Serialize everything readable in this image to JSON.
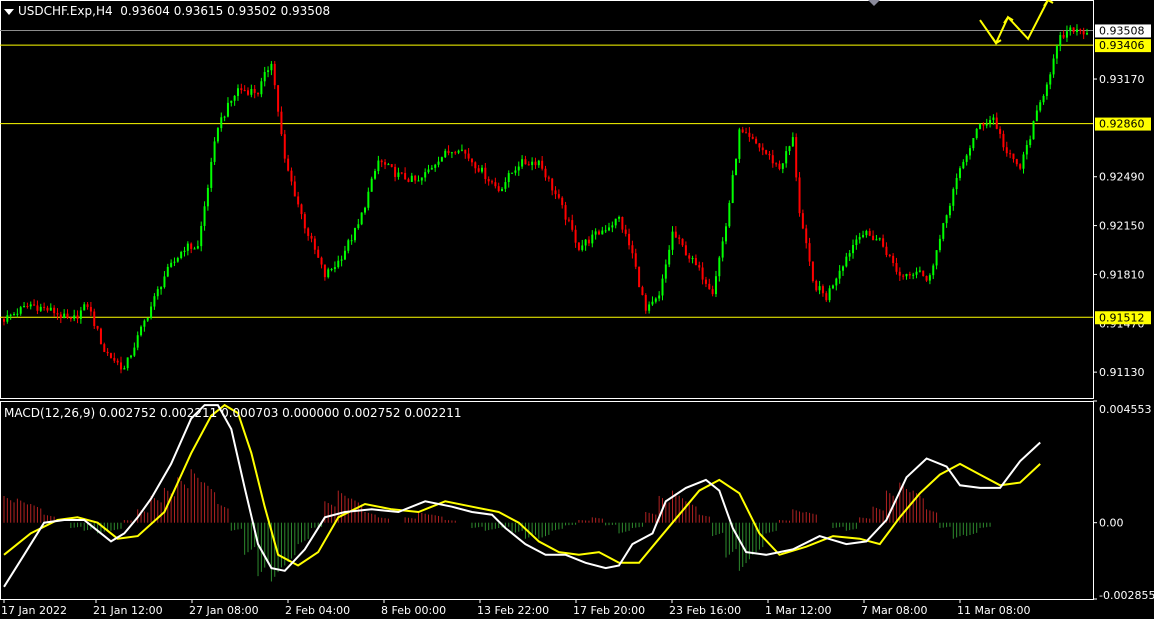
{
  "header": {
    "symbol": "USDCHF.Exp,H4",
    "ohlc": "0.93604 0.93615 0.93502 0.93508"
  },
  "macd_header": {
    "label": "MACD(12,26,9) 0.002752 0.002211 0.000703 0.000000 0.002752 0.002211"
  },
  "colors": {
    "background": "#000000",
    "bull_candle": "#00ff00",
    "bear_candle": "#ff0000",
    "level_line": "#ffff00",
    "macd_line": "#ffffff",
    "signal_line": "#ffff00",
    "hist_pos": "#b22222",
    "hist_neg": "#2e8b2e",
    "grid_frame": "#ffffff"
  },
  "chart_data": [
    {
      "type": "candlestick",
      "panel": "price",
      "ylim": [
        0.9095,
        0.9372
      ],
      "y_ticks": [
        "0.93170",
        "0.92490",
        "0.92150",
        "0.91810",
        "0.91130"
      ],
      "current_price": "0.93508",
      "levels": [
        {
          "value": 0.93406,
          "label": "0.93406"
        },
        {
          "value": 0.9286,
          "label": "0.92860"
        },
        {
          "value": 0.91512,
          "label": "0.91512"
        }
      ],
      "overlap_tick": "0.91470",
      "x_tick_labels": [
        "17 Jan 2022",
        "21 Jan 12:00",
        "27 Jan 08:00",
        "2 Feb 04:00",
        "8 Feb 00:00",
        "13 Feb 22:00",
        "17 Feb 20:00",
        "23 Feb 16:00",
        "1 Mar 12:00",
        "7 Mar 08:00",
        "11 Mar 08:00"
      ],
      "close_path": [
        [
          0,
          0.915
        ],
        [
          8,
          0.916
        ],
        [
          15,
          0.9155
        ],
        [
          20,
          0.9148
        ],
        [
          25,
          0.916
        ],
        [
          30,
          0.9128
        ],
        [
          36,
          0.9115
        ],
        [
          42,
          0.9148
        ],
        [
          48,
          0.918
        ],
        [
          54,
          0.92
        ],
        [
          58,
          0.92
        ],
        [
          64,
          0.9285
        ],
        [
          70,
          0.931
        ],
        [
          76,
          0.9308
        ],
        [
          80,
          0.933
        ],
        [
          84,
          0.926
        ],
        [
          90,
          0.9215
        ],
        [
          96,
          0.918
        ],
        [
          100,
          0.919
        ],
        [
          106,
          0.9215
        ],
        [
          112,
          0.926
        ],
        [
          118,
          0.925
        ],
        [
          124,
          0.9245
        ],
        [
          130,
          0.9262
        ],
        [
          136,
          0.927
        ],
        [
          142,
          0.9255
        ],
        [
          148,
          0.924
        ],
        [
          154,
          0.9258
        ],
        [
          160,
          0.926
        ],
        [
          166,
          0.9232
        ],
        [
          172,
          0.92
        ],
        [
          178,
          0.921
        ],
        [
          184,
          0.922
        ],
        [
          188,
          0.9195
        ],
        [
          192,
          0.9155
        ],
        [
          196,
          0.9165
        ],
        [
          200,
          0.921
        ],
        [
          206,
          0.919
        ],
        [
          212,
          0.917
        ],
        [
          216,
          0.9215
        ],
        [
          220,
          0.928
        ],
        [
          226,
          0.927
        ],
        [
          232,
          0.9255
        ],
        [
          236,
          0.9275
        ],
        [
          238,
          0.9225
        ],
        [
          242,
          0.9175
        ],
        [
          246,
          0.9165
        ],
        [
          250,
          0.9185
        ],
        [
          256,
          0.921
        ],
        [
          262,
          0.9205
        ],
        [
          268,
          0.918
        ],
        [
          274,
          0.9185
        ],
        [
          276,
          0.9175
        ],
        [
          280,
          0.9205
        ],
        [
          284,
          0.924
        ],
        [
          288,
          0.9265
        ],
        [
          292,
          0.9285
        ],
        [
          296,
          0.929
        ],
        [
          300,
          0.9265
        ],
        [
          304,
          0.9255
        ],
        [
          308,
          0.9285
        ],
        [
          312,
          0.9315
        ],
        [
          316,
          0.9345
        ],
        [
          320,
          0.9352
        ],
        [
          324,
          0.935
        ]
      ],
      "forecast_arrow": [
        [
          0.9358,
          0.9342
        ],
        [
          0.9342,
          0.936
        ],
        [
          0.936,
          0.9345
        ],
        [
          0.9345,
          0.9372
        ]
      ]
    },
    {
      "type": "macd",
      "panel": "indicator",
      "ylim": [
        -0.002855,
        0.004553
      ],
      "y_ticks": [
        "0.004553",
        "0.00",
        "-0.002855"
      ],
      "macd": [
        [
          0,
          -0.0024
        ],
        [
          6,
          -0.0012
        ],
        [
          12,
          0.0
        ],
        [
          18,
          0.0001
        ],
        [
          24,
          0.0001
        ],
        [
          28,
          -0.0003
        ],
        [
          32,
          -0.0007
        ],
        [
          36,
          -0.0004
        ],
        [
          40,
          0.0002
        ],
        [
          44,
          0.0009
        ],
        [
          50,
          0.0022
        ],
        [
          56,
          0.0039
        ],
        [
          60,
          0.0044
        ],
        [
          64,
          0.0044
        ],
        [
          68,
          0.0035
        ],
        [
          72,
          0.0013
        ],
        [
          76,
          -0.0008
        ],
        [
          80,
          -0.0017
        ],
        [
          84,
          -0.0018
        ],
        [
          90,
          -0.001
        ],
        [
          96,
          0.0002
        ],
        [
          102,
          0.0004
        ],
        [
          110,
          0.0005
        ],
        [
          118,
          0.0004
        ],
        [
          126,
          0.0008
        ],
        [
          134,
          0.0006
        ],
        [
          140,
          0.0004
        ],
        [
          146,
          0.0003
        ],
        [
          150,
          -0.0002
        ],
        [
          156,
          -0.0008
        ],
        [
          162,
          -0.0012
        ],
        [
          168,
          -0.0012
        ],
        [
          174,
          -0.0015
        ],
        [
          180,
          -0.0017
        ],
        [
          184,
          -0.0016
        ],
        [
          188,
          -0.0008
        ],
        [
          194,
          -0.0004
        ],
        [
          198,
          0.0008
        ],
        [
          204,
          0.0013
        ],
        [
          210,
          0.0016
        ],
        [
          214,
          0.0012
        ],
        [
          218,
          -0.0002
        ],
        [
          222,
          -0.0011
        ],
        [
          228,
          -0.0012
        ],
        [
          236,
          -0.001
        ],
        [
          244,
          -0.0005
        ],
        [
          252,
          -0.0008
        ],
        [
          258,
          -0.0007
        ],
        [
          264,
          0.0001
        ],
        [
          270,
          0.0017
        ],
        [
          276,
          0.0024
        ],
        [
          282,
          0.0021
        ],
        [
          286,
          0.0014
        ],
        [
          292,
          0.0013
        ],
        [
          298,
          0.0013
        ],
        [
          304,
          0.0023
        ],
        [
          310,
          0.003
        ]
      ],
      "signal": [
        [
          0,
          -0.0012
        ],
        [
          8,
          -0.0004
        ],
        [
          16,
          0.0001
        ],
        [
          22,
          0.0002
        ],
        [
          28,
          0.0
        ],
        [
          34,
          -0.0006
        ],
        [
          40,
          -0.0005
        ],
        [
          48,
          0.0004
        ],
        [
          56,
          0.0026
        ],
        [
          62,
          0.004
        ],
        [
          66,
          0.0044
        ],
        [
          70,
          0.0041
        ],
        [
          74,
          0.0026
        ],
        [
          78,
          0.0006
        ],
        [
          82,
          -0.0012
        ],
        [
          88,
          -0.0016
        ],
        [
          94,
          -0.0011
        ],
        [
          100,
          0.0002
        ],
        [
          108,
          0.0007
        ],
        [
          116,
          0.0005
        ],
        [
          124,
          0.0004
        ],
        [
          132,
          0.0008
        ],
        [
          140,
          0.0006
        ],
        [
          148,
          0.0004
        ],
        [
          154,
          0.0
        ],
        [
          160,
          -0.0007
        ],
        [
          166,
          -0.0011
        ],
        [
          172,
          -0.0012
        ],
        [
          178,
          -0.0011
        ],
        [
          184,
          -0.0015
        ],
        [
          190,
          -0.0015
        ],
        [
          196,
          -0.0006
        ],
        [
          202,
          0.0003
        ],
        [
          208,
          0.0012
        ],
        [
          214,
          0.0016
        ],
        [
          220,
          0.0011
        ],
        [
          226,
          -0.0004
        ],
        [
          232,
          -0.0012
        ],
        [
          240,
          -0.0009
        ],
        [
          248,
          -0.0005
        ],
        [
          256,
          -0.0006
        ],
        [
          262,
          -0.0008
        ],
        [
          268,
          0.0002
        ],
        [
          274,
          0.0011
        ],
        [
          280,
          0.0018
        ],
        [
          286,
          0.0022
        ],
        [
          292,
          0.0018
        ],
        [
          298,
          0.0014
        ],
        [
          304,
          0.0015
        ],
        [
          310,
          0.0022
        ]
      ],
      "histogram": [
        [
          0,
          0.001
        ],
        [
          4,
          0.0009
        ],
        [
          8,
          0.0007
        ],
        [
          12,
          0.0003
        ],
        [
          16,
          0.0
        ],
        [
          20,
          -0.0002
        ],
        [
          24,
          -0.0003
        ],
        [
          28,
          -0.0004
        ],
        [
          32,
          -0.0003
        ],
        [
          36,
          0.0001
        ],
        [
          40,
          0.0005
        ],
        [
          44,
          0.001
        ],
        [
          48,
          0.0013
        ],
        [
          52,
          0.0017
        ],
        [
          56,
          0.002
        ],
        [
          60,
          0.0015
        ],
        [
          64,
          0.0007
        ],
        [
          68,
          -0.0003
        ],
        [
          72,
          -0.0012
        ],
        [
          76,
          -0.002
        ],
        [
          80,
          -0.0022
        ],
        [
          84,
          -0.0016
        ],
        [
          88,
          -0.0008
        ],
        [
          92,
          -0.0002
        ],
        [
          96,
          0.0008
        ],
        [
          100,
          0.0012
        ],
        [
          104,
          0.0009
        ],
        [
          108,
          0.0004
        ],
        [
          112,
          0.0002
        ],
        [
          116,
          0.0
        ],
        [
          120,
          0.0002
        ],
        [
          124,
          0.0004
        ],
        [
          128,
          0.0003
        ],
        [
          132,
          0.0001
        ],
        [
          136,
          0.0
        ],
        [
          140,
          -0.0002
        ],
        [
          144,
          -0.0003
        ],
        [
          148,
          -0.0002
        ],
        [
          152,
          -0.0004
        ],
        [
          156,
          -0.0006
        ],
        [
          160,
          -0.0006
        ],
        [
          164,
          -0.0003
        ],
        [
          168,
          -0.0001
        ],
        [
          172,
          0.0001
        ],
        [
          176,
          0.0002
        ],
        [
          180,
          -0.0001
        ],
        [
          184,
          -0.0004
        ],
        [
          188,
          -0.0002
        ],
        [
          192,
          0.0004
        ],
        [
          196,
          0.001
        ],
        [
          200,
          0.0012
        ],
        [
          204,
          0.0008
        ],
        [
          208,
          0.0003
        ],
        [
          212,
          -0.0005
        ],
        [
          216,
          -0.0013
        ],
        [
          220,
          -0.0018
        ],
        [
          224,
          -0.0012
        ],
        [
          228,
          -0.0004
        ],
        [
          232,
          0.0001
        ],
        [
          236,
          0.0005
        ],
        [
          240,
          0.0004
        ],
        [
          244,
          0.0
        ],
        [
          248,
          -0.0002
        ],
        [
          252,
          -0.0003
        ],
        [
          256,
          0.0002
        ],
        [
          260,
          0.0006
        ],
        [
          264,
          0.0012
        ],
        [
          268,
          0.0015
        ],
        [
          272,
          0.0012
        ],
        [
          276,
          0.0005
        ],
        [
          280,
          -0.0002
        ],
        [
          284,
          -0.0006
        ],
        [
          288,
          -0.0005
        ],
        [
          292,
          -0.0002
        ],
        [
          296,
          0.0002
        ],
        [
          300,
          0.0007
        ],
        [
          304,
          0.0008
        ],
        [
          308,
          0.0007
        ]
      ]
    }
  ]
}
